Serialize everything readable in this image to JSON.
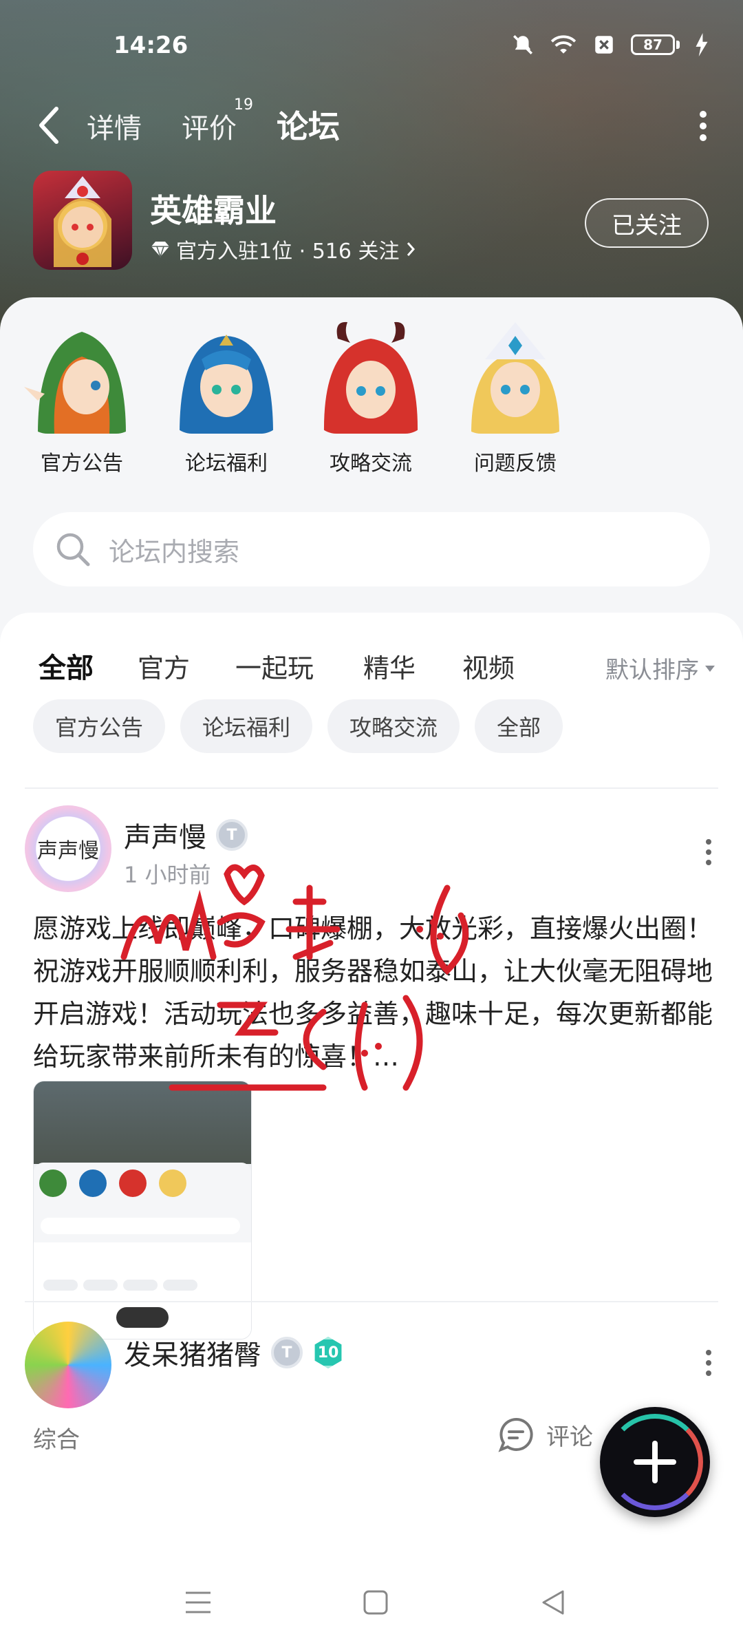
{
  "status_bar": {
    "time": "14:26",
    "battery": "87"
  },
  "nav": {
    "tabs": [
      "详情",
      "评价",
      "论坛"
    ],
    "rating_badge": "19",
    "active_tab": "论坛"
  },
  "game": {
    "title": "英雄霸业",
    "meta_text": "官方入驻1位 · 516 关注",
    "follow_label": "已关注"
  },
  "categories": [
    {
      "label": "官方公告"
    },
    {
      "label": "论坛福利"
    },
    {
      "label": "攻略交流"
    },
    {
      "label": "问题反馈"
    }
  ],
  "search": {
    "placeholder": "论坛内搜索"
  },
  "feed_tabs": [
    "全部",
    "官方",
    "一起玩",
    "精华",
    "视频"
  ],
  "sort_label": "默认排序",
  "chips": [
    "官方公告",
    "论坛福利",
    "攻略交流",
    "全部"
  ],
  "post": {
    "avatar_text": "声声慢",
    "username": "声声慢",
    "time": "1 小时前",
    "body": "愿游戏上线即巅峰，口碑爆棚，大放光彩，直接爆火出圈！祝游戏开服顺顺利利，服务器稳如泰山，让大伙毫无阻碍地开启游戏！活动玩法也多多益善，趣味十足，每次更新都能给玩家带来前所未有的惊喜！…",
    "category": "综合",
    "comment_label": "评论"
  },
  "post2": {
    "username": "发呆猪猪臀",
    "level": "10"
  },
  "colors": {
    "accent": "#27c3a9",
    "text": "#222222",
    "muted": "#9a9ca2"
  }
}
